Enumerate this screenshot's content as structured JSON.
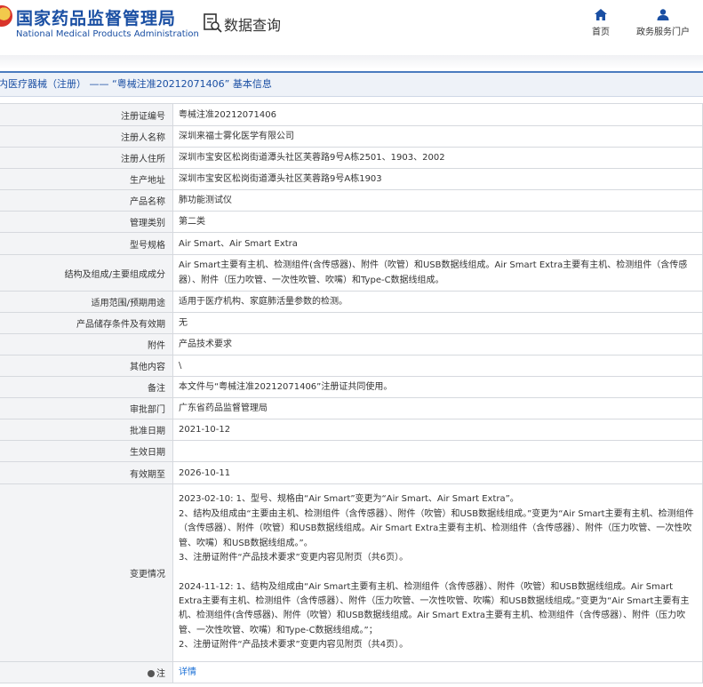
{
  "header": {
    "logo_cn": "国家药品监督管理局",
    "logo_en": "National Medical Products Administration",
    "query_title": "数据查询",
    "nav": [
      {
        "label": "首页",
        "icon": "home-icon"
      },
      {
        "label": "政务服务门户",
        "icon": "user-icon"
      }
    ],
    "accent_color": "#1a4fa3"
  },
  "page_title": "内医疗器械（注册） —— “粤械注准20212071406” 基本信息",
  "rows": [
    {
      "label": "注册证编号",
      "value": "粤械注准20212071406"
    },
    {
      "label": "注册人名称",
      "value": "深圳来福士雾化医学有限公司"
    },
    {
      "label": "注册人住所",
      "value": "深圳市宝安区松岗街道潭头社区芙蓉路9号A栋2501、1903、2002"
    },
    {
      "label": "生产地址",
      "value": "深圳市宝安区松岗街道潭头社区芙蓉路9号A栋1903"
    },
    {
      "label": "产品名称",
      "value": "肺功能测试仪"
    },
    {
      "label": "管理类别",
      "value": "第二类"
    },
    {
      "label": "型号规格",
      "value": "Air Smart、Air Smart Extra"
    },
    {
      "label": "结构及组成/主要组成成分",
      "value": "Air Smart主要有主机、检测组件(含传感器)、附件（吹管）和USB数据线组成。Air Smart Extra主要有主机、检测组件（含传感器）、附件（压力吹管、一次性吹管、吹嘴）和Type-C数据线组成。"
    },
    {
      "label": "适用范围/预期用途",
      "value": "适用于医疗机构、家庭肺活量参数的检测。"
    },
    {
      "label": "产品储存条件及有效期",
      "value": "无"
    },
    {
      "label": "附件",
      "value": "产品技术要求"
    },
    {
      "label": "其他内容",
      "value": "\\"
    },
    {
      "label": "备注",
      "value": "本文件与“粤械注准20212071406”注册证共同使用。"
    },
    {
      "label": "审批部门",
      "value": "广东省药品监督管理局"
    },
    {
      "label": "批准日期",
      "value": "2021-10-12"
    },
    {
      "label": "生效日期",
      "value": ""
    },
    {
      "label": "有效期至",
      "value": "2026-10-11"
    }
  ],
  "changes": {
    "label": "变更情况",
    "lines_1": [
      "2023-02-10: 1、型号、规格由“Air Smart”变更为“Air Smart、Air Smart Extra”。",
      "2、结构及组成由“主要由主机、检测组件（含传感器）、附件（吹管）和USB数据线组成。”变更为“Air Smart主要有主机、检测组件（含传感器）、附件（吹管）和USB数据线组成。Air Smart Extra主要有主机、检测组件（含传感器）、附件（压力吹管、一次性吹管、吹嘴）和USB数据线组成。”。",
      "3、注册证附件“产品技术要求”变更内容见附页（共6页）。"
    ],
    "lines_2": [
      "2024-11-12: 1、结构及组成由“Air Smart主要有主机、检测组件（含传感器）、附件（吹管）和USB数据线组成。Air Smart Extra主要有主机、检测组件（含传感器）、附件（压力吹管、一次性吹管、吹嘴）和USB数据线组成。”变更为“Air Smart主要有主机、检测组件(含传感器)、附件（吹管）和USB数据线组成。Air Smart Extra主要有主机、检测组件（含传感器）、附件（压力吹管、一次性吹管、吹嘴）和Type-C数据线组成。”；",
      "2、注册证附件“产品技术要求”变更内容见附页（共4页）。"
    ]
  },
  "note_row": {
    "label": "注",
    "value": "详情",
    "link_color": "#1a6fd6"
  }
}
